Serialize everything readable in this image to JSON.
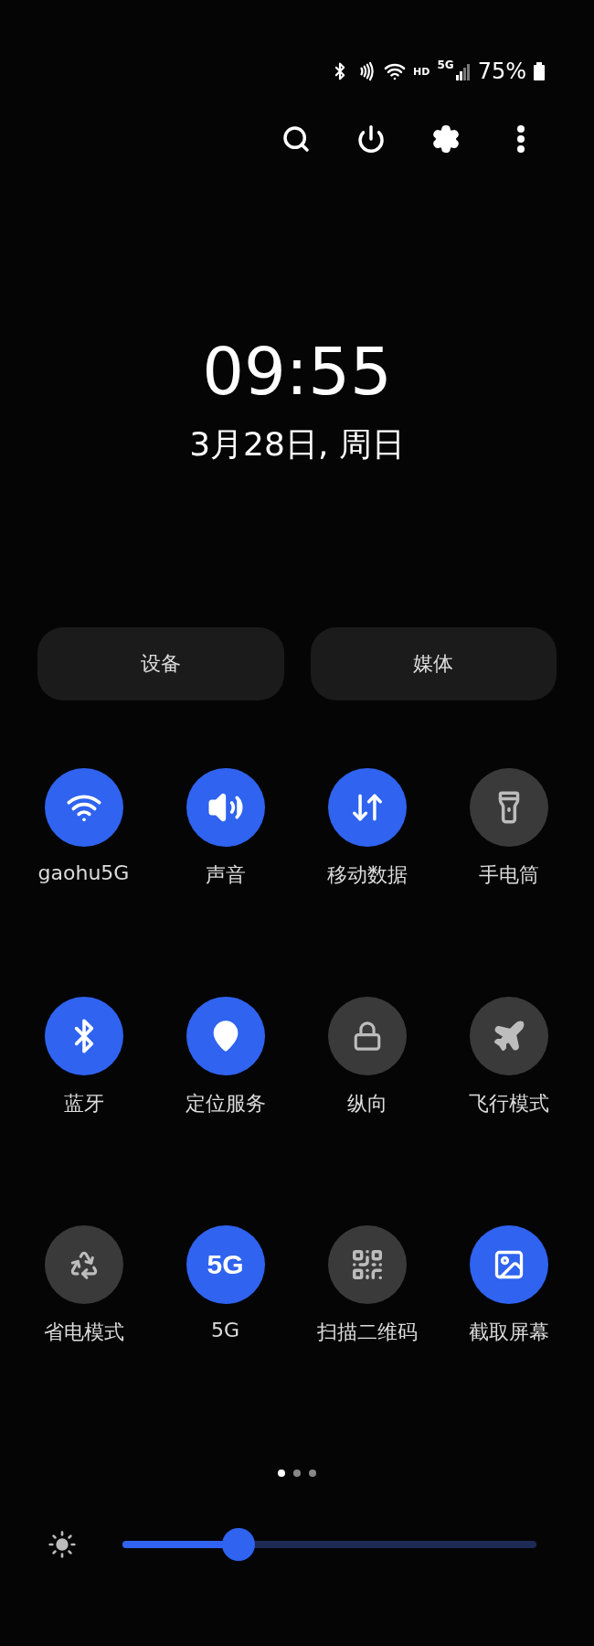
{
  "status_bar": {
    "network": "HD",
    "generation": "5G",
    "battery": "75%"
  },
  "toolbar": [
    {
      "kind": "search"
    },
    {
      "kind": "power"
    },
    {
      "kind": "settings"
    },
    {
      "kind": "more"
    }
  ],
  "clock": {
    "time": "09:55",
    "date": "3月28日, 周日"
  },
  "buttons": [
    "设备",
    "媒体"
  ],
  "tiles": [
    {
      "kind": "wifi",
      "label": "gaohu5G",
      "on": true
    },
    {
      "kind": "sound",
      "label": "声音",
      "on": true
    },
    {
      "kind": "data",
      "label": "移动数据",
      "on": true
    },
    {
      "kind": "flashlight",
      "label": "手电筒",
      "on": false
    },
    {
      "kind": "bluetooth",
      "label": "蓝牙",
      "on": true
    },
    {
      "kind": "location",
      "label": "定位服务",
      "on": true
    },
    {
      "kind": "rotation",
      "label": "纵向",
      "on": false
    },
    {
      "kind": "airplane",
      "label": "飞行模式",
      "on": false
    },
    {
      "kind": "battery",
      "label": "省电模式",
      "on": false
    },
    {
      "kind": "text",
      "glyph": "5G",
      "label": "5G",
      "on": true
    },
    {
      "kind": "qr",
      "label": "扫描二维码",
      "on": false
    },
    {
      "kind": "screenshot",
      "label": "截取屏幕",
      "on": true
    }
  ],
  "pages": [
    {
      "selected": true
    },
    {
      "selected": false
    },
    {
      "selected": false
    }
  ],
  "brightness": {
    "level": 0.28
  }
}
